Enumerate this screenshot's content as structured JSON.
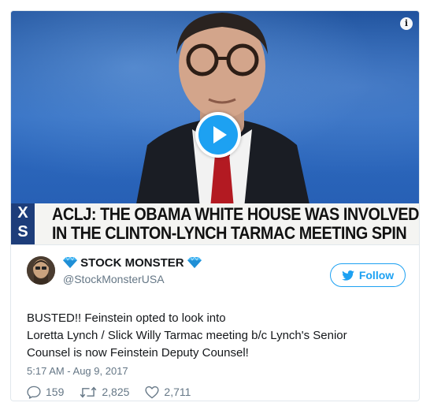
{
  "video": {
    "headline_line1": "ACLJ: THE OBAMA WHITE HOUSE WAS INVOLVED",
    "headline_line2": "IN THE CLINTON-LYNCH TARMAC MEETING SPIN",
    "side_label": "X S",
    "info_label": "i"
  },
  "author": {
    "name": "STOCK MONSTER",
    "handle": "@StockMonsterUSA"
  },
  "follow_label": "Follow",
  "tweet": {
    "line1": "BUSTED!! Feinstein opted to look into",
    "line2": "Loretta Lynch / Slick Willy Tarmac meeting b/c Lynch's Senior",
    "line3": "Counsel is now Feinstein Deputy Counsel!"
  },
  "timestamp": "5:17 AM - Aug 9, 2017",
  "stats": {
    "replies": "159",
    "retweets": "2,825",
    "likes": "2,711"
  },
  "colors": {
    "accent": "#1da1f2",
    "text": "#14171a",
    "muted": "#657786",
    "gem": "#3ab0f0"
  },
  "icons": [
    "info-icon",
    "play-icon",
    "diamond-icon",
    "twitter-bird-icon",
    "reply-icon",
    "retweet-icon",
    "heart-icon"
  ]
}
